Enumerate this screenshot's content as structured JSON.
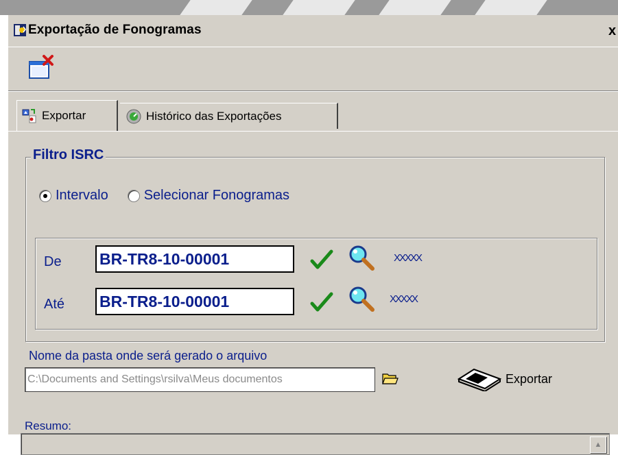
{
  "window": {
    "title": "Exportação de Fonogramas",
    "close_glyph": "x"
  },
  "toolbar": {
    "close_window_icon": "close-window-icon"
  },
  "tabs": [
    {
      "label": "Exportar",
      "icon": "export-tab-icon",
      "active": true
    },
    {
      "label": "Histórico das Exportações",
      "icon": "history-tab-icon",
      "active": false
    }
  ],
  "filter": {
    "legend": "Filtro ISRC",
    "radio_interval": "Intervalo",
    "radio_select": "Selecionar Fonogramas",
    "selected": "Intervalo",
    "from_label": "De",
    "from_value": "BR-TR8-10-00001",
    "from_name": "XXXXX",
    "to_label": "Até",
    "to_value": "BR-TR8-10-00001",
    "to_name": "XXXXX"
  },
  "output": {
    "folder_label": "Nome da pasta onde será gerado o arquivo",
    "folder_value": "C:\\Documents and Settings\\rsilva\\Meus documentos",
    "export_label": "Exportar"
  },
  "summary": {
    "label": "Resumo:"
  },
  "colors": {
    "label_blue": "#0a1e8c",
    "panel_gray": "#d4d0c8"
  }
}
